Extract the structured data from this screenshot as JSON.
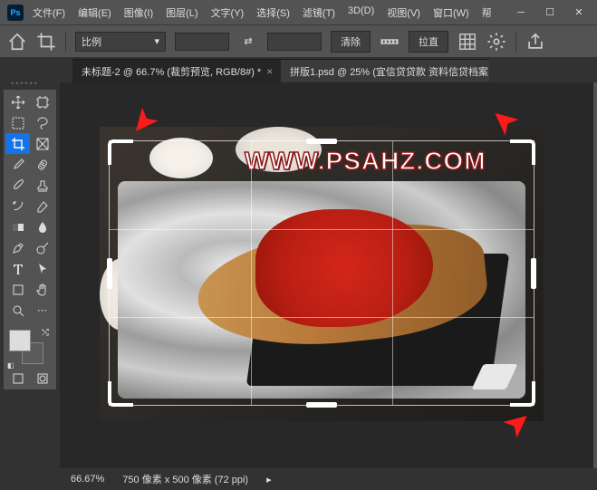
{
  "menu": {
    "file": "文件(F)",
    "edit": "编辑(E)",
    "image": "图像(I)",
    "layer": "图层(L)",
    "type": "文字(Y)",
    "select": "选择(S)",
    "filter": "滤镜(T)",
    "threed": "3D(D)",
    "view": "视图(V)",
    "window": "窗口(W)",
    "help": "帮"
  },
  "options": {
    "ratio_label": "比例",
    "clear": "清除",
    "straighten": "拉直"
  },
  "tabs": {
    "active": "未标题-2 @ 66.7% (裁剪预览, RGB/8#) *",
    "inactive": "拼版1.psd @ 25% (宜信贷贷款 资料信贷档案..."
  },
  "watermark": "WWW.PSAHZ.COM",
  "status": {
    "zoom": "66.67%",
    "dims": "750 像素 x 500 像素 (72 ppi)"
  },
  "icons": {
    "home": "home-icon",
    "crop": "crop-icon",
    "swap": "swap-icon",
    "grid": "grid-icon",
    "gear": "gear-icon",
    "check": "check-icon",
    "cancel": "cancel-icon",
    "reset": "reset-icon"
  }
}
